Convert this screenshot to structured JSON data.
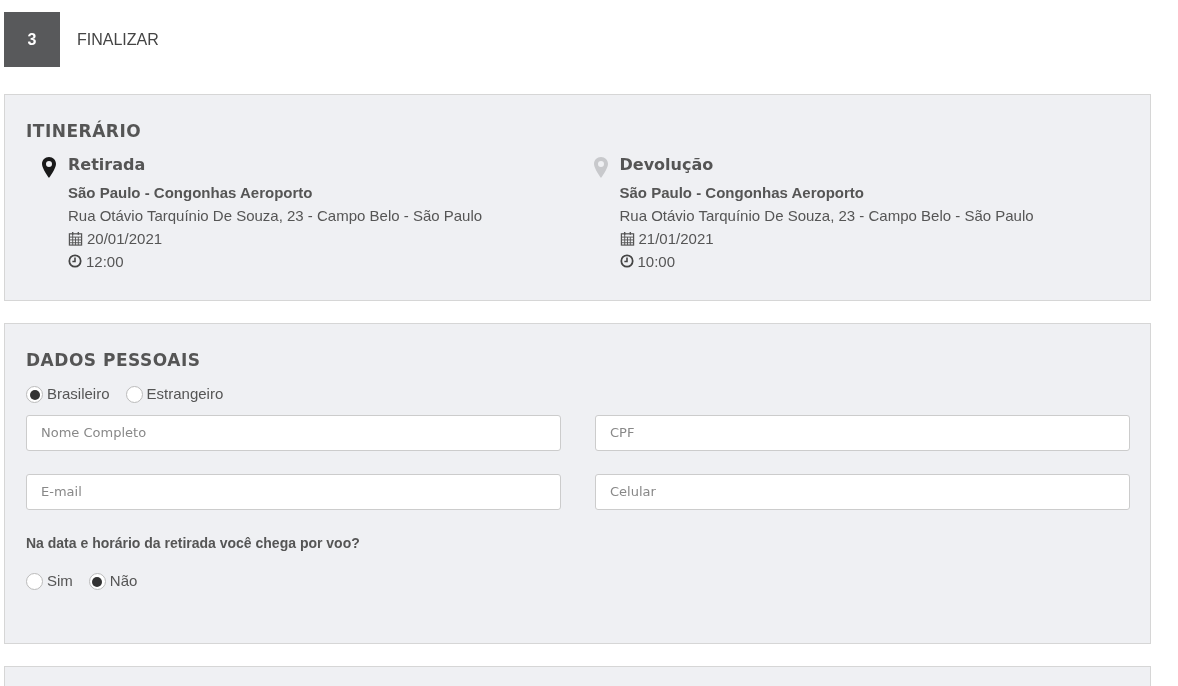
{
  "step": {
    "number": "3",
    "title": "FINALIZAR"
  },
  "itinerary": {
    "title": "ITINERÁRIO",
    "locations": [
      {
        "label": "Retirada",
        "color": "#1a1a1a",
        "place": "São Paulo - Congonhas Aeroporto",
        "address": "Rua Otávio Tarquínio De Souza, 23 - Campo Belo - São Paulo",
        "date": "20/01/2021",
        "time": "12:00"
      },
      {
        "label": "Devolução",
        "color": "#c8c9cc",
        "place": "São Paulo - Congonhas Aeroporto",
        "address": "Rua Otávio Tarquínio De Souza, 23 - Campo Belo - São Paulo",
        "date": "21/01/2021",
        "time": "10:00"
      }
    ]
  },
  "personal": {
    "title": "DADOS PESSOAIS",
    "nationality": [
      {
        "label": "Brasileiro",
        "selected": true
      },
      {
        "label": "Estrangeiro",
        "selected": false
      }
    ],
    "fields": [
      {
        "placeholder": "Nome Completo"
      },
      {
        "placeholder": "CPF"
      },
      {
        "placeholder": "E-mail"
      },
      {
        "placeholder": "Celular"
      }
    ],
    "question": "Na data e horário da retirada você chega por voo?",
    "flight": [
      {
        "label": "Sim",
        "selected": false
      },
      {
        "label": "Não",
        "selected": true
      }
    ]
  }
}
